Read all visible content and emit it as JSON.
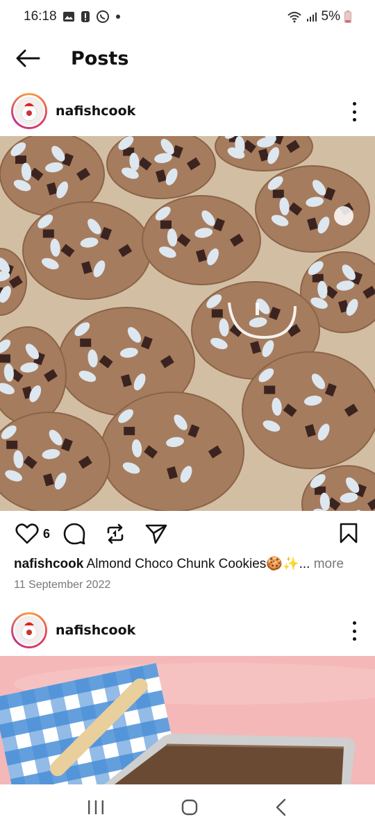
{
  "status_bar": {
    "time": "16:18",
    "battery": "5%",
    "icons_left": [
      "gallery-icon",
      "alert-icon",
      "whatsapp-icon",
      "dot-icon"
    ],
    "icons_right": [
      "wifi-icon",
      "signal-icon",
      "battery-icon"
    ]
  },
  "header": {
    "back_icon": "arrow-left-icon",
    "title": "Posts"
  },
  "posts": [
    {
      "username": "nafishcook",
      "image": "almond-choco-chunk-cookies-photo",
      "likes": "6",
      "caption_user": "nafishcook",
      "caption_text": " Almond Choco Chunk Cookies🍪✨...",
      "caption_more": " more",
      "date": "11 September 2022"
    },
    {
      "username": "nafishcook",
      "image": "chocolate-spread-photo"
    }
  ],
  "nav": {
    "recents_icon": "recents-icon",
    "home_icon": "home-icon",
    "back_icon": "back-chevron-icon"
  }
}
